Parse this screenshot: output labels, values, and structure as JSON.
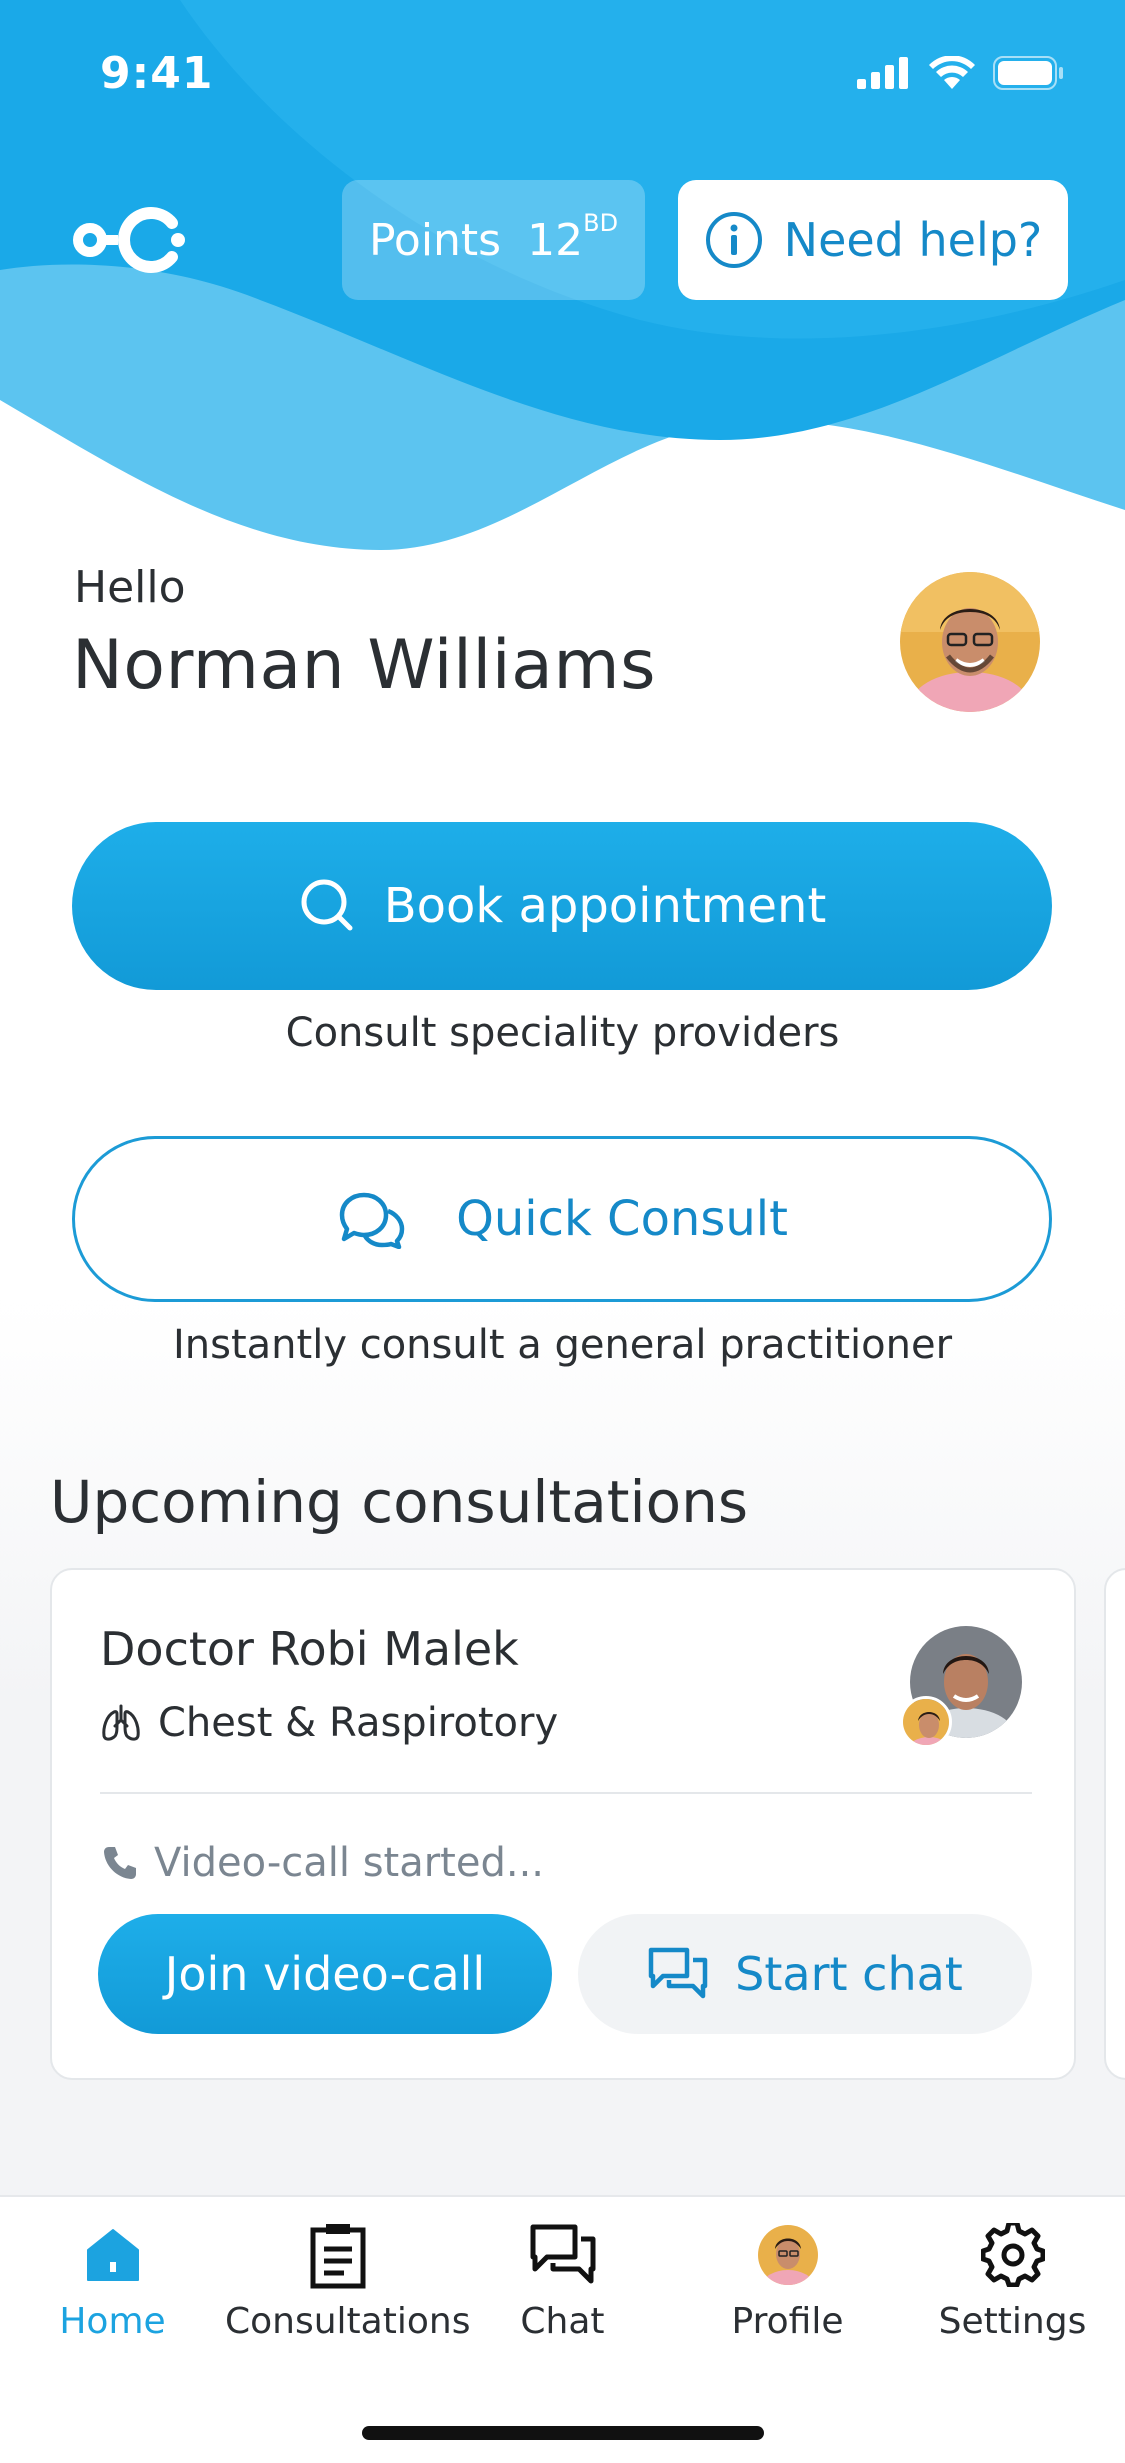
{
  "status_bar": {
    "time": "9:41"
  },
  "header": {
    "logo_name": "app-logo",
    "points_label": "Points",
    "points_value": "12",
    "points_currency": "BD",
    "help_label": "Need help?"
  },
  "greeting": {
    "hello": "Hello",
    "name": "Norman Williams"
  },
  "actions": {
    "book_label": "Book appointment",
    "book_caption": "Consult speciality providers",
    "quick_label": "Quick Consult",
    "quick_caption": "Instantly consult a general practitioner"
  },
  "upcoming": {
    "title": "Upcoming consultations",
    "card": {
      "doctor": "Doctor Robi Malek",
      "specialty": "Chest & Raspirotory",
      "status": "Video-call started...",
      "join_label": "Join video-call",
      "chat_label": "Start chat"
    }
  },
  "tabs": [
    {
      "label": "Home",
      "icon": "home-icon",
      "active": true
    },
    {
      "label": "Consultations",
      "icon": "clipboard-icon",
      "active": false
    },
    {
      "label": "Chat",
      "icon": "chat-icon",
      "active": false
    },
    {
      "label": "Profile",
      "icon": "avatar",
      "active": false
    },
    {
      "label": "Settings",
      "icon": "gear-icon",
      "active": false
    }
  ],
  "colors": {
    "primary": "#1ca3e0",
    "primary_dark": "#1589c8",
    "text": "#2b2f33",
    "muted": "#7b8691"
  }
}
